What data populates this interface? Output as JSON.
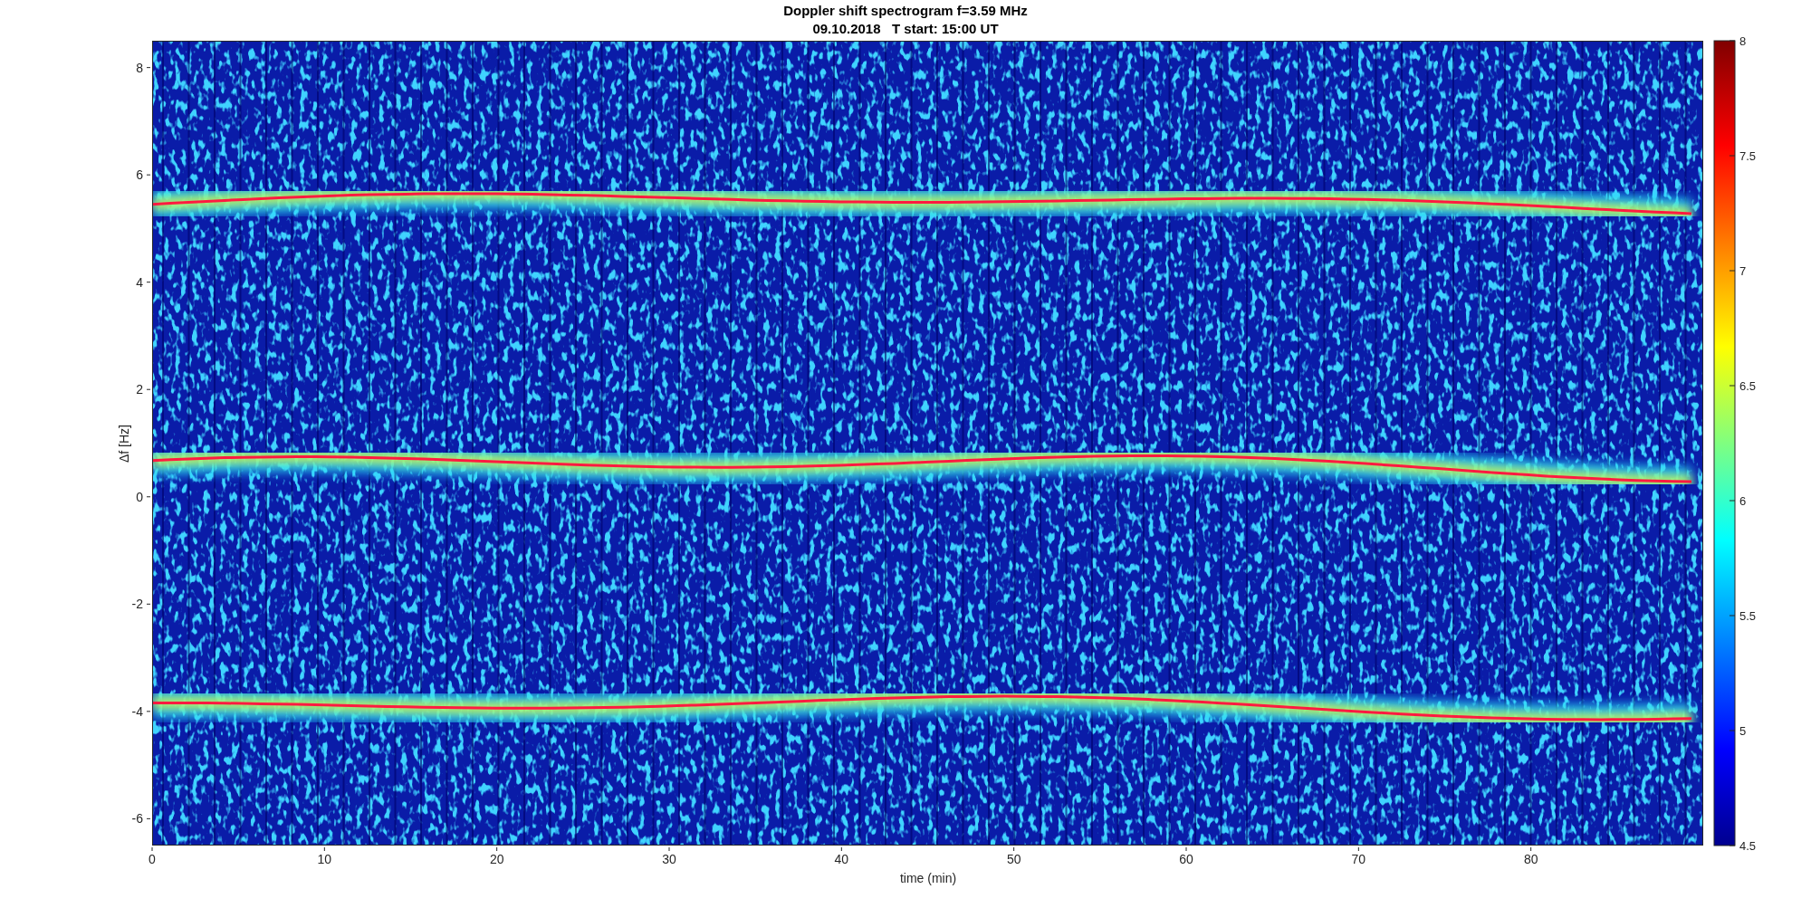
{
  "figure": {
    "title": "Doppler shift spectrogram f=3.59 MHz",
    "subtitle": "09.10.2018   T start: 15:00 UT"
  },
  "axes": {
    "xlabel": "time (min)",
    "ylabel": "Δf [Hz]",
    "xticks": [
      "0",
      "10",
      "20",
      "30",
      "40",
      "50",
      "60",
      "70",
      "80"
    ],
    "yticks": [
      "8",
      "6",
      "4",
      "2",
      "0",
      "-2",
      "-4",
      "-6"
    ]
  },
  "colorbar": {
    "ticks": [
      "8",
      "7.5",
      "7",
      "6.5",
      "6",
      "5.5",
      "5",
      "4.5"
    ]
  }
}
